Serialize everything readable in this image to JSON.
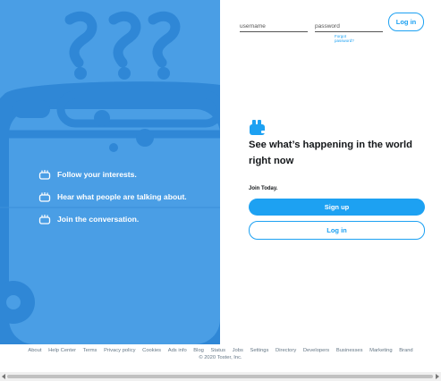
{
  "features": [
    {
      "label": "Follow your interests.",
      "icon": "toaster-icon"
    },
    {
      "label": "Hear what people are talking about.",
      "icon": "toaster-icon"
    },
    {
      "label": "Join the conversation.",
      "icon": "toaster-icon"
    }
  ],
  "login": {
    "username_placeholder": "username",
    "password_placeholder": "password",
    "forgot_password": "Forgot password?",
    "login_button": "Log in"
  },
  "main": {
    "headline": "See what’s happening in the world right now",
    "join_label": "Join Today.",
    "signup_button": "Sign up",
    "login_button": "Log in"
  },
  "footer": {
    "links": [
      "About",
      "Help Center",
      "Terms",
      "Privacy policy",
      "Cookies",
      "Ads info",
      "Blog",
      "Status",
      "Jobs",
      "Settings",
      "Directory",
      "Developers",
      "Businesses",
      "Marketing",
      "Brand"
    ],
    "copyright": "© 2020 Toster, Inc."
  },
  "colors": {
    "accent": "#1da1f2",
    "panel": "#4a9ee5",
    "panel_shape": "#3b8fd9"
  }
}
